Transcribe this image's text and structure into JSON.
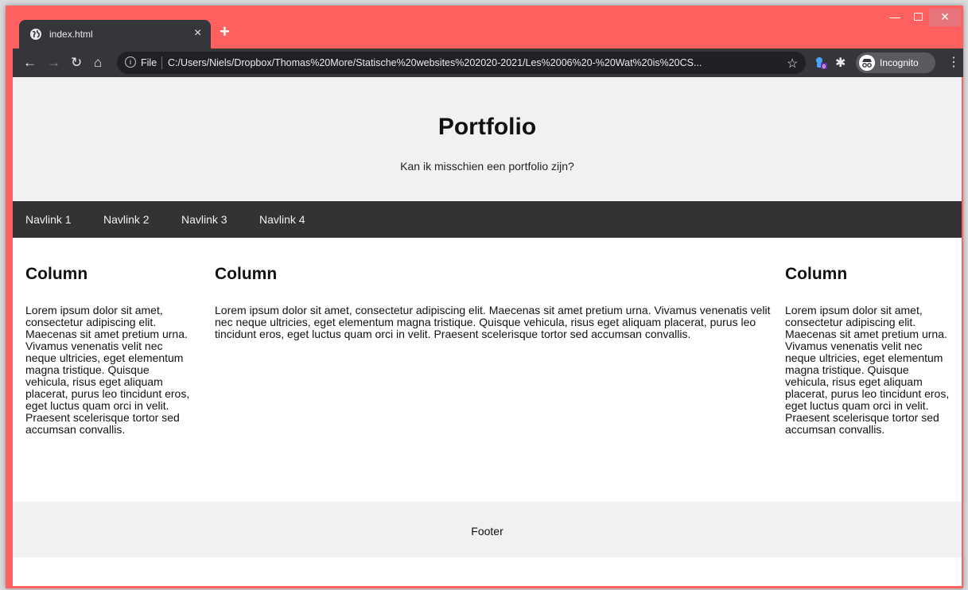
{
  "browser": {
    "tab_title": "index.html",
    "new_tab": "+",
    "tab_close": "×",
    "address_scheme": "File",
    "url": "C:/Users/Niels/Dropbox/Thomas%20More/Statische%20websites%202020-2021/Les%2006%20-%20Wat%20is%20CS...",
    "extension_badge": "0",
    "incognito_label": "Incognito",
    "colors": {
      "frame": "#ff6161",
      "toolbar": "#35363a",
      "omnibox": "#202124"
    }
  },
  "page": {
    "header": {
      "title": "Portfolio",
      "subtitle": "Kan ik misschien een portfolio zijn?"
    },
    "nav": [
      "Navlink 1",
      "Navlink 2",
      "Navlink 3",
      "Navlink 4"
    ],
    "columns": [
      {
        "heading": "Column",
        "text": "Lorem ipsum dolor sit amet, consectetur adipiscing elit. Maecenas sit amet pretium urna. Vivamus venenatis velit nec neque ultricies, eget elementum magna tristique. Quisque vehicula, risus eget aliquam placerat, purus leo tincidunt eros, eget luctus quam orci in velit. Praesent scelerisque tortor sed accumsan convallis."
      },
      {
        "heading": "Column",
        "text": "Lorem ipsum dolor sit amet, consectetur adipiscing elit. Maecenas sit amet pretium urna. Vivamus venenatis velit nec neque ultricies, eget elementum magna tristique. Quisque vehicula, risus eget aliquam placerat, purus leo tincidunt eros, eget luctus quam orci in velit. Praesent scelerisque tortor sed accumsan convallis."
      },
      {
        "heading": "Column",
        "text": "Lorem ipsum dolor sit amet, consectetur adipiscing elit. Maecenas sit amet pretium urna. Vivamus venenatis velit nec neque ultricies, eget elementum magna tristique. Quisque vehicula, risus eget aliquam placerat, purus leo tincidunt eros, eget luctus quam orci in velit. Praesent scelerisque tortor sed accumsan convallis."
      }
    ],
    "footer": "Footer",
    "colors": {
      "header_bg": "#f1f1f1",
      "nav_bg": "#333333",
      "nav_text": "#f2f2f2"
    }
  }
}
